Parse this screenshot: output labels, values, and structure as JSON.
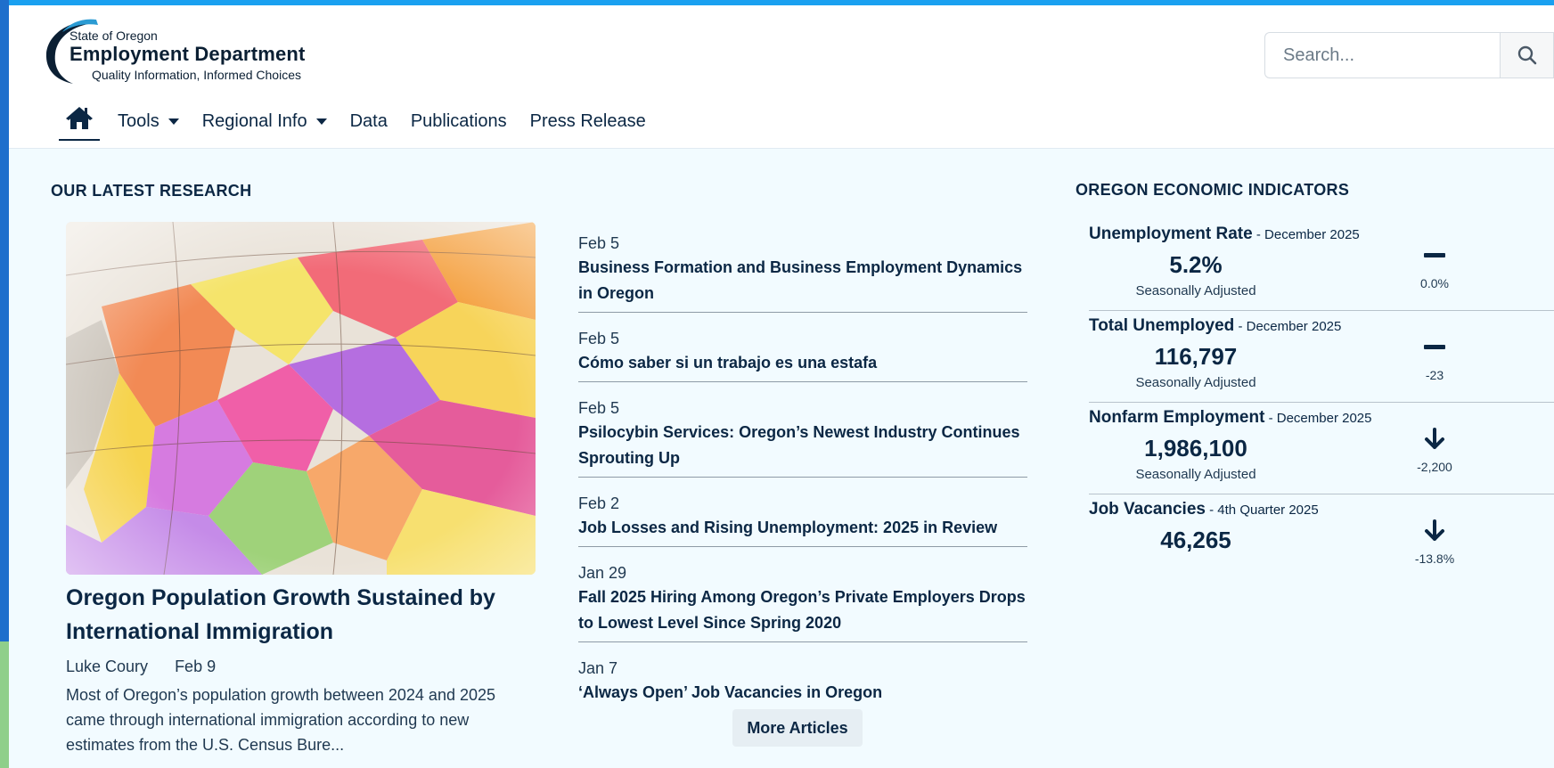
{
  "logo": {
    "line1": "State of Oregon",
    "line2": "Employment Department",
    "line3": "Quality Information, Informed Choices"
  },
  "search": {
    "placeholder": "Search...",
    "icon": "search-icon"
  },
  "nav": {
    "home_icon": "home-icon",
    "items": [
      {
        "label": "Tools",
        "dropdown": true
      },
      {
        "label": "Regional Info",
        "dropdown": true
      },
      {
        "label": "Data",
        "dropdown": false
      },
      {
        "label": "Publications",
        "dropdown": false
      },
      {
        "label": "Press Release",
        "dropdown": false
      }
    ]
  },
  "research": {
    "heading": "OUR LATEST RESEARCH",
    "featured": {
      "image": "map-image",
      "title": "Oregon Population Growth Sustained by International Immigration",
      "author": "Luke Coury",
      "date": "Feb 9",
      "description": "Most of Oregon’s population growth between 2024 and 2025 came through international immigration according to new estimates from the U.S. Census Bure..."
    },
    "articles": [
      {
        "date": "Feb 5",
        "title": "Business Formation and Business Employment Dynamics in Oregon"
      },
      {
        "date": "Feb 5",
        "title": "Cómo saber si un trabajo es una estafa"
      },
      {
        "date": "Feb 5",
        "title": "Psilocybin Services: Oregon’s Newest Industry Continues Sprouting Up"
      },
      {
        "date": "Feb 2",
        "title": "Job Losses and Rising Unemployment: 2025 in Review"
      },
      {
        "date": "Jan 29",
        "title": "Fall 2025 Hiring Among Oregon’s Private Employers Drops to Lowest Level Since Spring 2020"
      },
      {
        "date": "Jan 7",
        "title": "‘Always Open’ Job Vacancies in Oregon"
      }
    ],
    "more_label": "More Articles"
  },
  "indicators": {
    "heading": "OREGON ECONOMIC INDICATORS",
    "items": [
      {
        "name": "Unemployment Rate",
        "period": " - December 2025",
        "value": "5.2%",
        "note": "Seasonally Adjusted",
        "trend": "flat",
        "change": "0.0%"
      },
      {
        "name": "Total Unemployed",
        "period": " - December 2025",
        "value": "116,797",
        "note": "Seasonally Adjusted",
        "trend": "flat",
        "change": "-23"
      },
      {
        "name": "Nonfarm Employment",
        "period": " - December 2025",
        "value": "1,986,100",
        "note": "Seasonally Adjusted",
        "trend": "down",
        "change": "-2,200"
      },
      {
        "name": "Job Vacancies",
        "period": " - 4th Quarter 2025",
        "value": "46,265",
        "note": "",
        "trend": "down",
        "change": "-13.8%"
      }
    ]
  },
  "colors": {
    "topbar": "#1aa0f0",
    "page_bg": "#f2fbff",
    "text_dark": "#0b2744"
  }
}
